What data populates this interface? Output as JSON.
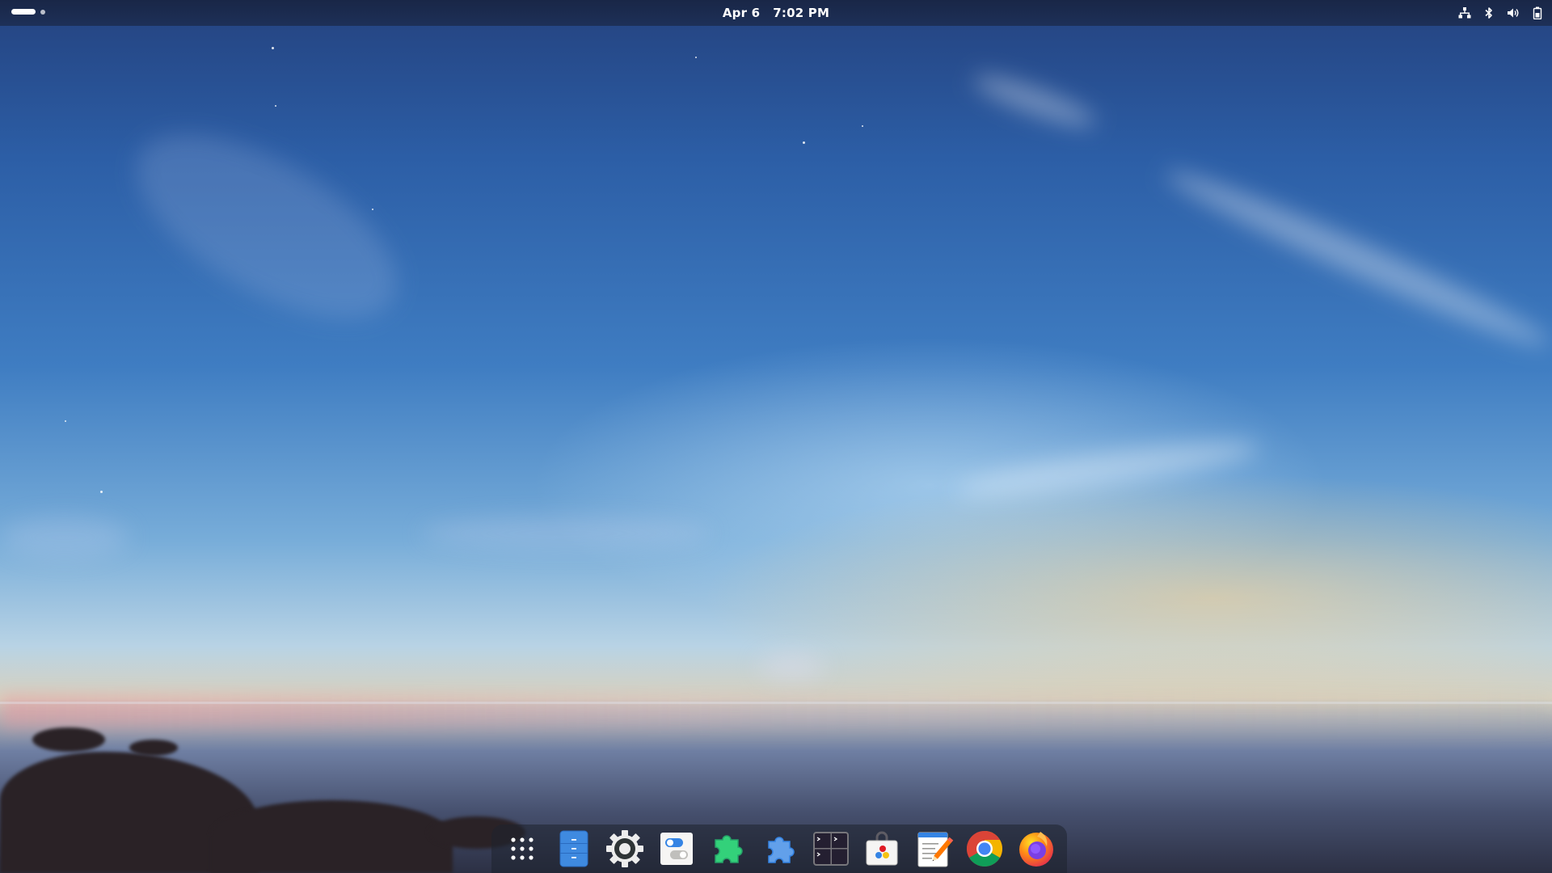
{
  "top_panel": {
    "date": "Apr 6",
    "time": "7:02 PM",
    "status_icons": [
      "network-wired-icon",
      "bluetooth-icon",
      "volume-icon",
      "battery-icon"
    ]
  },
  "dock": {
    "items": [
      "show-apps-icon",
      "files-icon",
      "settings-icon",
      "tweaks-icon",
      "extensions-green-icon",
      "extension-manager-icon",
      "terminal-icon",
      "software-store-icon",
      "text-editor-icon",
      "chrome-icon",
      "firefox-icon"
    ]
  },
  "colors": {
    "sky_top": "#24427f",
    "sky_mid": "#3f7dc2",
    "horizon_glow": "#ffd28c",
    "panel_bg": "#182442"
  }
}
